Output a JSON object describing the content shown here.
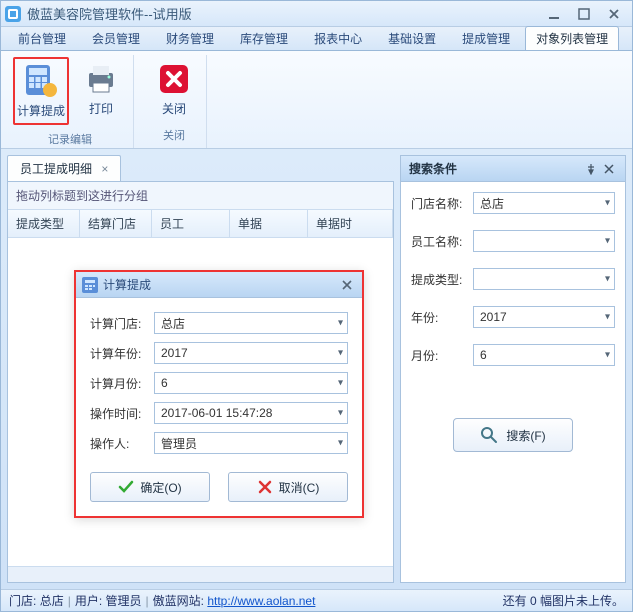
{
  "window": {
    "title": "傲蓝美容院管理软件--试用版"
  },
  "tabs": [
    {
      "label": "前台管理"
    },
    {
      "label": "会员管理"
    },
    {
      "label": "财务管理"
    },
    {
      "label": "库存管理"
    },
    {
      "label": "报表中心"
    },
    {
      "label": "基础设置"
    },
    {
      "label": "提成管理"
    },
    {
      "label": "对象列表管理"
    }
  ],
  "active_tab_index": 7,
  "ribbon": {
    "groups": [
      {
        "label": "记录编辑",
        "items": [
          {
            "name": "calc-commission",
            "label": "计算提成",
            "highlight": true
          },
          {
            "name": "print",
            "label": "打印"
          }
        ]
      },
      {
        "label": "关闭",
        "items": [
          {
            "name": "close",
            "label": "关闭"
          }
        ]
      }
    ]
  },
  "doc_tab": "员工提成明细",
  "grid": {
    "group_hint": "拖动列标题到这进行分组",
    "columns": [
      "提成类型",
      "结算门店",
      "员工",
      "单据",
      "单据时"
    ]
  },
  "dialog": {
    "title": "计算提成",
    "fields": {
      "calc_store_label": "计算门店:",
      "calc_store_value": "总店",
      "calc_year_label": "计算年份:",
      "calc_year_value": "2017",
      "calc_month_label": "计算月份:",
      "calc_month_value": "6",
      "op_time_label": "操作时间:",
      "op_time_value": "2017-06-01 15:47:28",
      "op_user_label": "操作人:",
      "op_user_value": "管理员"
    },
    "ok": "确定(O)",
    "cancel": "取消(C)"
  },
  "search": {
    "title": "搜索条件",
    "store_label": "门店名称:",
    "store_value": "总店",
    "employee_label": "员工名称:",
    "employee_value": "",
    "type_label": "提成类型:",
    "type_value": "",
    "year_label": "年份:",
    "year_value": "2017",
    "month_label": "月份:",
    "month_value": "6",
    "button": "搜索(F)"
  },
  "status": {
    "store_label": "门店:",
    "store": "总店",
    "user_label": "用户:",
    "user": "管理员",
    "site_label": "傲蓝网站:",
    "url": "http://www.aolan.net",
    "right": "还有 0 幅图片未上传。"
  }
}
